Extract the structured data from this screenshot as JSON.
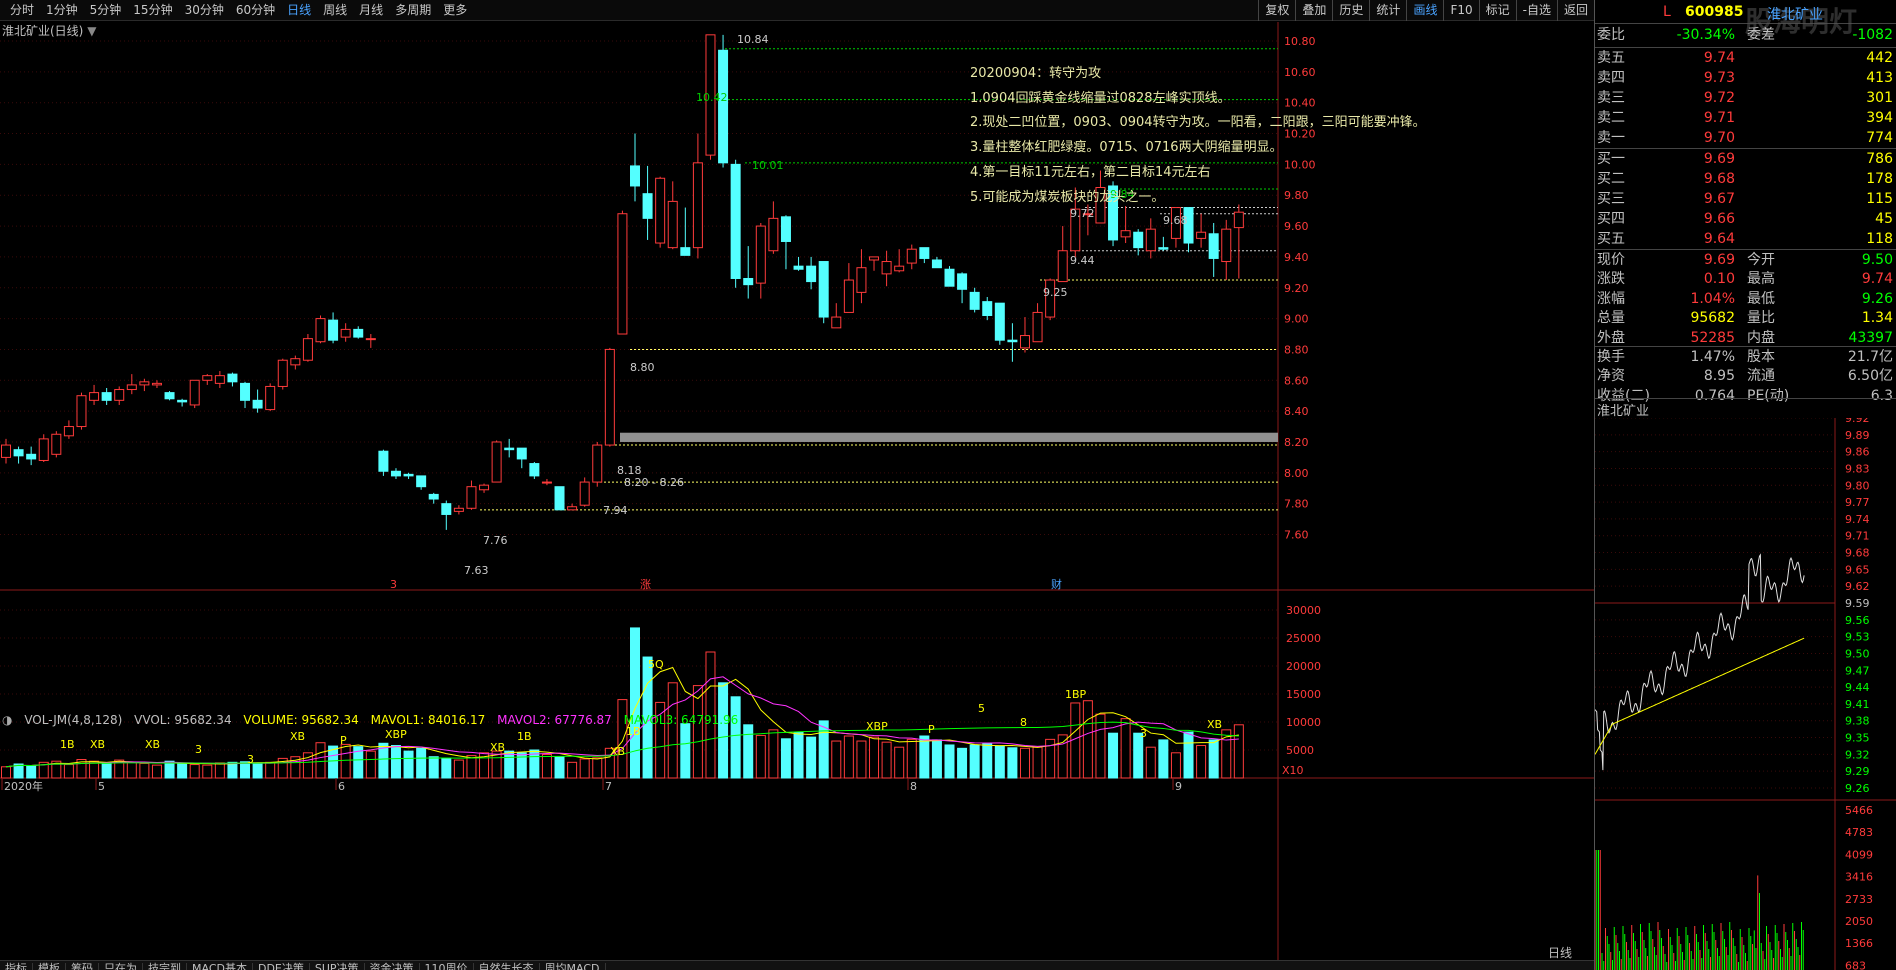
{
  "toolbar": {
    "periods": [
      "分时",
      "1分钟",
      "5分钟",
      "15分钟",
      "30分钟",
      "60分钟",
      "日线",
      "周线",
      "月线",
      "多周期",
      "更多"
    ],
    "active_period": "日线",
    "right_buttons": [
      "复权",
      "叠加",
      "历史",
      "统计",
      "画线",
      "F10",
      "标记",
      "-自选",
      "返回"
    ],
    "active_right": "画线"
  },
  "chart_title": "淮北矿业(日线)",
  "annotation": [
    "20200904：转守为攻",
    "1.0904回踩黄金线缩量过0828左峰实顶线。",
    "2.现处二凹位置，0903、0904转守为攻。一阳看，二阳跟，三阳可能要冲锋。",
    "3.量柱整体红肥绿瘦。0715、0716两大阴缩量明显。",
    "4.第一目标11元左右，第二目标14元左右",
    "5.可能成为煤炭板块的龙头之一。"
  ],
  "price_axis": [
    "10.80",
    "10.60",
    "10.40",
    "10.20",
    "10.00",
    "9.80",
    "9.60",
    "9.40",
    "9.20",
    "9.00",
    "8.80",
    "8.60",
    "8.40",
    "8.20",
    "8.00",
    "7.80",
    "7.60"
  ],
  "price_labels": {
    "high": "10.84",
    "p1042": "10.42",
    "p1001": "10.01",
    "p984": "9.84",
    "p972": "9.72",
    "p968": "9.68",
    "p944": "9.44",
    "p925": "9.25",
    "p880": "8.80",
    "p818": "8.18",
    "zone": "8.20 - 8.26",
    "p794": "7.94",
    "p776": "7.76",
    "low": "7.63"
  },
  "markers": {
    "m1": "3",
    "m2": "涨",
    "m3": "财"
  },
  "volume_indicator": {
    "name": "VOL-JM(4,8,128)",
    "vvol": "VVOL: 95682.34",
    "volume": "VOLUME: 95682.34",
    "mavol1": "MAVOL1: 84016.17",
    "mavol2": "MAVOL2: 67776.87",
    "mavol3": "MAVOL3: 64791.96"
  },
  "volume_axis": [
    "30000",
    "25000",
    "20000",
    "15000",
    "10000",
    "5000"
  ],
  "volume_unit": "X10",
  "vol_tags": {
    "a": "1B",
    "b": "XB",
    "c": "XB",
    "d": "3",
    "e": "P",
    "f": "XB",
    "g": "XBP",
    "h": "3",
    "i": "XB",
    "j": "1B",
    "k": "XB",
    "l": "1B",
    "m": "5Q",
    "n": "XBP",
    "o": "P",
    "p": "5",
    "q": "8",
    "r": "1BP",
    "s": "3",
    "t": "XB"
  },
  "date_axis": [
    "2020年",
    "5",
    "6",
    "7",
    "8",
    "9"
  ],
  "bottom_tabs": [
    "指标",
    "模板",
    "筹码",
    "只在为",
    "技宗到",
    "MACD基本",
    "DDE决策",
    "SUP决策",
    "资金决策",
    "110周价",
    "自然生长态",
    "周均MACD"
  ],
  "bottom_right": "日线",
  "quote": {
    "prefix": "L",
    "code": "600985",
    "name": "淮北矿业",
    "logo": "股海明灯",
    "weibi_label": "委比",
    "weibi": "-30.34%",
    "weicha_label": "委差",
    "weicha": "-1082",
    "asks": [
      {
        "label": "卖五",
        "price": "9.74",
        "vol": "442"
      },
      {
        "label": "卖四",
        "price": "9.73",
        "vol": "413"
      },
      {
        "label": "卖三",
        "price": "9.72",
        "vol": "301"
      },
      {
        "label": "卖二",
        "price": "9.71",
        "vol": "394"
      },
      {
        "label": "卖一",
        "price": "9.70",
        "vol": "774"
      }
    ],
    "bids": [
      {
        "label": "买一",
        "price": "9.69",
        "vol": "786"
      },
      {
        "label": "买二",
        "price": "9.68",
        "vol": "178"
      },
      {
        "label": "买三",
        "price": "9.67",
        "vol": "115"
      },
      {
        "label": "买四",
        "price": "9.66",
        "vol": "45"
      },
      {
        "label": "买五",
        "price": "9.64",
        "vol": "118"
      }
    ],
    "stats": [
      {
        "l": "现价",
        "v": "9.69",
        "l2": "今开",
        "v2": "9.50"
      },
      {
        "l": "涨跌",
        "v": "0.10",
        "l2": "最高",
        "v2": "9.74"
      },
      {
        "l": "涨幅",
        "v": "1.04%",
        "l2": "最低",
        "v2": "9.26"
      },
      {
        "l": "总量",
        "v": "95682",
        "l2": "量比",
        "v2": "1.34"
      },
      {
        "l": "外盘",
        "v": "52285",
        "l2": "内盘",
        "v2": "43397"
      },
      {
        "l": "换手",
        "v": "1.47%",
        "l2": "股本",
        "v2": "21.7亿"
      },
      {
        "l": "净资",
        "v": "8.95",
        "l2": "流通",
        "v2": "6.50亿"
      },
      {
        "l": "收益(二)",
        "v": "0.764",
        "l2": "PE(动)",
        "v2": "6.3"
      }
    ],
    "mini_title": "淮北矿业",
    "mini_price_axis": [
      "9.92",
      "9.89",
      "9.86",
      "9.83",
      "9.80",
      "9.77",
      "9.74",
      "9.71",
      "9.68",
      "9.65",
      "9.62",
      "9.59",
      "9.56",
      "9.53",
      "9.50",
      "9.47",
      "9.44",
      "9.41",
      "9.38",
      "9.35",
      "9.32",
      "9.29",
      "9.26"
    ],
    "mini_vol_axis": [
      "5466",
      "4783",
      "4099",
      "3416",
      "2733",
      "2050",
      "1366",
      "683"
    ],
    "colors": {
      "up": "#ff3b3b",
      "down": "#54ffff",
      "ma1": "#ffff00",
      "ma2": "#ff33ff",
      "ma3": "#00ff00"
    }
  },
  "chart_data": {
    "type": "candlestick",
    "candles": [
      [
        8.1,
        8.18,
        8.22,
        8.06
      ],
      [
        8.15,
        8.11,
        8.17,
        8.06
      ],
      [
        8.12,
        8.09,
        8.17,
        8.05
      ],
      [
        8.08,
        8.22,
        8.25,
        8.07
      ],
      [
        8.12,
        8.25,
        8.27,
        8.1
      ],
      [
        8.24,
        8.3,
        8.34,
        8.22
      ],
      [
        8.3,
        8.5,
        8.52,
        8.28
      ],
      [
        8.47,
        8.52,
        8.57,
        8.44
      ],
      [
        8.52,
        8.47,
        8.55,
        8.44
      ],
      [
        8.47,
        8.54,
        8.56,
        8.44
      ],
      [
        8.54,
        8.57,
        8.64,
        8.51
      ],
      [
        8.57,
        8.59,
        8.61,
        8.53
      ],
      [
        8.57,
        8.58,
        8.6,
        8.55
      ],
      [
        8.52,
        8.48,
        8.53,
        8.47
      ],
      [
        8.47,
        8.46,
        8.48,
        8.43
      ],
      [
        8.44,
        8.6,
        8.6,
        8.42
      ],
      [
        8.6,
        8.63,
        8.64,
        8.57
      ],
      [
        8.58,
        8.63,
        8.66,
        8.55
      ],
      [
        8.64,
        8.59,
        8.65,
        8.56
      ],
      [
        8.58,
        8.47,
        8.59,
        8.42
      ],
      [
        8.47,
        8.42,
        8.54,
        8.39
      ],
      [
        8.41,
        8.56,
        8.58,
        8.4
      ],
      [
        8.56,
        8.73,
        8.74,
        8.54
      ],
      [
        8.7,
        8.74,
        8.76,
        8.67
      ],
      [
        8.73,
        8.87,
        8.9,
        8.72
      ],
      [
        8.85,
        9.0,
        9.02,
        8.84
      ],
      [
        8.99,
        8.86,
        9.04,
        8.84
      ],
      [
        8.88,
        8.93,
        8.97,
        8.85
      ],
      [
        8.93,
        8.88,
        8.95,
        8.87
      ],
      [
        8.87,
        8.87,
        8.9,
        8.81
      ],
      [
        8.14,
        8.01,
        8.15,
        7.98
      ],
      [
        8.01,
        7.98,
        8.03,
        7.96
      ],
      [
        7.99,
        7.98,
        8.0,
        7.96
      ],
      [
        7.98,
        7.91,
        7.98,
        7.89
      ],
      [
        7.86,
        7.83,
        7.87,
        7.8
      ],
      [
        7.8,
        7.73,
        7.82,
        7.63
      ],
      [
        7.75,
        7.77,
        7.79,
        7.73
      ],
      [
        7.77,
        7.91,
        7.95,
        7.76
      ],
      [
        7.89,
        7.92,
        7.93,
        7.87
      ],
      [
        7.94,
        8.2,
        8.21,
        7.94
      ],
      [
        8.16,
        8.15,
        8.22,
        8.1
      ],
      [
        8.16,
        8.09,
        8.15,
        8.03
      ],
      [
        8.06,
        7.98,
        8.07,
        7.96
      ],
      [
        7.94,
        7.94,
        7.96,
        7.92
      ],
      [
        7.91,
        7.76,
        7.91,
        7.76
      ],
      [
        7.76,
        7.78,
        7.8,
        7.76
      ],
      [
        7.79,
        7.94,
        7.97,
        7.78
      ],
      [
        7.94,
        8.18,
        8.2,
        7.91
      ],
      [
        8.18,
        8.8,
        8.81,
        8.17
      ],
      [
        8.9,
        9.68,
        9.7,
        8.9
      ],
      [
        9.99,
        9.86,
        10.2,
        9.76
      ],
      [
        9.81,
        9.65,
        9.99,
        9.51
      ],
      [
        9.49,
        9.91,
        9.92,
        9.46
      ],
      [
        9.46,
        9.76,
        9.89,
        9.45
      ],
      [
        9.46,
        9.41,
        9.72,
        9.42
      ],
      [
        9.46,
        10.01,
        10.2,
        9.39
      ],
      [
        10.06,
        10.84,
        10.84,
        10.03
      ],
      [
        10.74,
        10.01,
        10.84,
        9.98
      ],
      [
        10.0,
        9.26,
        10.03,
        9.2
      ],
      [
        9.26,
        9.22,
        9.47,
        9.13
      ],
      [
        9.23,
        9.6,
        9.62,
        9.13
      ],
      [
        9.44,
        9.65,
        9.76,
        9.42
      ],
      [
        9.66,
        9.5,
        9.67,
        9.32
      ],
      [
        9.34,
        9.32,
        9.4,
        9.31
      ],
      [
        9.34,
        9.24,
        9.4,
        9.19
      ],
      [
        9.37,
        9.01,
        9.36,
        8.97
      ],
      [
        8.94,
        9.01,
        9.1,
        8.98
      ],
      [
        9.04,
        9.25,
        9.36,
        9.09
      ],
      [
        9.17,
        9.33,
        9.45,
        9.1
      ],
      [
        9.38,
        9.4,
        9.4,
        9.31
      ],
      [
        9.29,
        9.37,
        9.44,
        9.21
      ],
      [
        9.31,
        9.34,
        9.45,
        9.3
      ],
      [
        9.36,
        9.45,
        9.48,
        9.32
      ],
      [
        9.46,
        9.39,
        9.45,
        9.36
      ],
      [
        9.38,
        9.33,
        9.4,
        9.33
      ],
      [
        9.32,
        9.21,
        9.34,
        9.27
      ],
      [
        9.29,
        9.19,
        9.3,
        9.1
      ],
      [
        9.17,
        9.06,
        9.2,
        9.04
      ],
      [
        9.11,
        9.02,
        9.14,
        8.99
      ],
      [
        9.1,
        8.86,
        9.09,
        8.83
      ],
      [
        8.86,
        8.85,
        8.97,
        8.72
      ],
      [
        8.81,
        8.89,
        9.01,
        8.78
      ],
      [
        8.85,
        9.04,
        9.1,
        8.85
      ],
      [
        9.01,
        9.25,
        9.26,
        8.99
      ],
      [
        9.24,
        9.44,
        9.6,
        9.26
      ],
      [
        9.44,
        9.71,
        9.85,
        9.4
      ],
      [
        9.68,
        9.68,
        9.74,
        9.54
      ],
      [
        9.62,
        9.85,
        9.96,
        9.62
      ],
      [
        9.86,
        9.51,
        9.89,
        9.47
      ],
      [
        9.53,
        9.57,
        9.73,
        9.49
      ],
      [
        9.56,
        9.46,
        9.58,
        9.41
      ],
      [
        9.44,
        9.58,
        9.65,
        9.39
      ],
      [
        9.46,
        9.45,
        9.53,
        9.44
      ],
      [
        9.52,
        9.72,
        9.71,
        9.46
      ],
      [
        9.72,
        9.49,
        9.72,
        9.43
      ],
      [
        9.52,
        9.56,
        9.68,
        9.46
      ],
      [
        9.55,
        9.39,
        9.62,
        9.27
      ],
      [
        9.37,
        9.58,
        9.64,
        9.25
      ],
      [
        9.59,
        9.69,
        9.74,
        9.26
      ]
    ],
    "volumes": [
      2000,
      2500,
      2200,
      2800,
      3000,
      2400,
      3300,
      3000,
      2500,
      3200,
      2800,
      2600,
      2300,
      3000,
      2600,
      2400,
      2300,
      2700,
      2800,
      2900,
      2600,
      2800,
      3500,
      3800,
      4500,
      6300,
      5700,
      6000,
      5600,
      4800,
      6200,
      5800,
      4800,
      5300,
      3800,
      3500,
      3200,
      4000,
      4500,
      4800,
      4800,
      4500,
      5000,
      4200,
      3800,
      2800,
      3400,
      3600,
      5300,
      14000,
      26800,
      21600,
      13500,
      17000,
      9700,
      16500,
      22500,
      17000,
      14500,
      9500,
      7600,
      8600,
      7000,
      8200,
      7300,
      10200,
      6600,
      7500,
      6600,
      7300,
      6400,
      5500,
      6900,
      7500,
      6800,
      5900,
      5300,
      5900,
      6200,
      5700,
      5400,
      5300,
      5500,
      6900,
      7700,
      13400,
      13800,
      11400,
      8000,
      10600,
      8000,
      5500,
      6800,
      4500,
      8200,
      5800,
      6800,
      8600,
      9500
    ]
  }
}
